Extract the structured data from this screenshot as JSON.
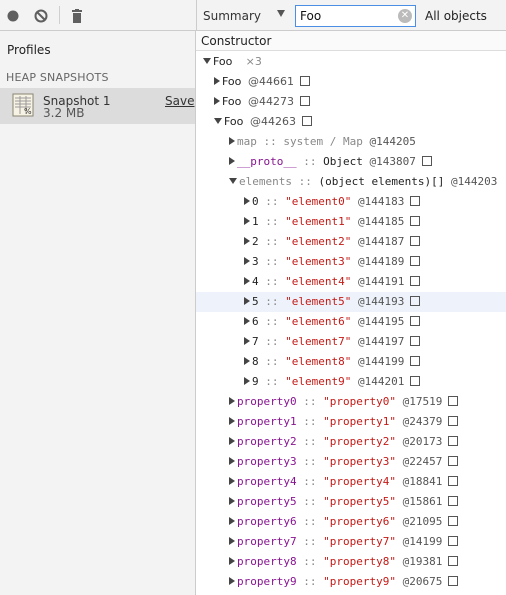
{
  "toolbar": {
    "record_icon": "record-icon",
    "clear_icon": "clear-icon",
    "trash_icon": "trash-icon",
    "view_mode": "Summary",
    "filter_value": "Foo",
    "object_filter": "All objects"
  },
  "sidebar": {
    "title": "Profiles",
    "section_header": "HEAP SNAPSHOTS",
    "snapshot": {
      "title": "Snapshot 1",
      "size": "3.2 MB",
      "save_label": "Save"
    }
  },
  "grid": {
    "column_header": "Constructor",
    "root": {
      "label": "Foo",
      "count": "×3"
    },
    "instances": [
      {
        "label": "Foo",
        "id": "@44661"
      },
      {
        "label": "Foo",
        "id": "@44273"
      },
      {
        "label": "Foo",
        "id": "@44263"
      }
    ],
    "expanded_instance_children": {
      "map": {
        "name": "map",
        "sep": "::",
        "value": "system / Map",
        "id": "@144205"
      },
      "proto": {
        "name": "__proto__",
        "sep": "::",
        "value": "Object",
        "id": "@143807"
      },
      "elements": {
        "name": "elements",
        "sep": "::",
        "value": "(object elements)[]",
        "id": "@144203"
      }
    },
    "elements": [
      {
        "index": "0",
        "value": "\"element0\"",
        "id": "@144183"
      },
      {
        "index": "1",
        "value": "\"element1\"",
        "id": "@144185"
      },
      {
        "index": "2",
        "value": "\"element2\"",
        "id": "@144187"
      },
      {
        "index": "3",
        "value": "\"element3\"",
        "id": "@144189"
      },
      {
        "index": "4",
        "value": "\"element4\"",
        "id": "@144191"
      },
      {
        "index": "5",
        "value": "\"element5\"",
        "id": "@144193"
      },
      {
        "index": "6",
        "value": "\"element6\"",
        "id": "@144195"
      },
      {
        "index": "7",
        "value": "\"element7\"",
        "id": "@144197"
      },
      {
        "index": "8",
        "value": "\"element8\"",
        "id": "@144199"
      },
      {
        "index": "9",
        "value": "\"element9\"",
        "id": "@144201"
      }
    ],
    "properties": [
      {
        "name": "property0",
        "value": "\"property0\"",
        "id": "@17519"
      },
      {
        "name": "property1",
        "value": "\"property1\"",
        "id": "@24379"
      },
      {
        "name": "property2",
        "value": "\"property2\"",
        "id": "@20173"
      },
      {
        "name": "property3",
        "value": "\"property3\"",
        "id": "@22457"
      },
      {
        "name": "property4",
        "value": "\"property4\"",
        "id": "@18841"
      },
      {
        "name": "property5",
        "value": "\"property5\"",
        "id": "@15861"
      },
      {
        "name": "property6",
        "value": "\"property6\"",
        "id": "@21095"
      },
      {
        "name": "property7",
        "value": "\"property7\"",
        "id": "@14199"
      },
      {
        "name": "property8",
        "value": "\"property8\"",
        "id": "@19381"
      },
      {
        "name": "property9",
        "value": "\"property9\"",
        "id": "@20675"
      }
    ],
    "separator": "::"
  }
}
